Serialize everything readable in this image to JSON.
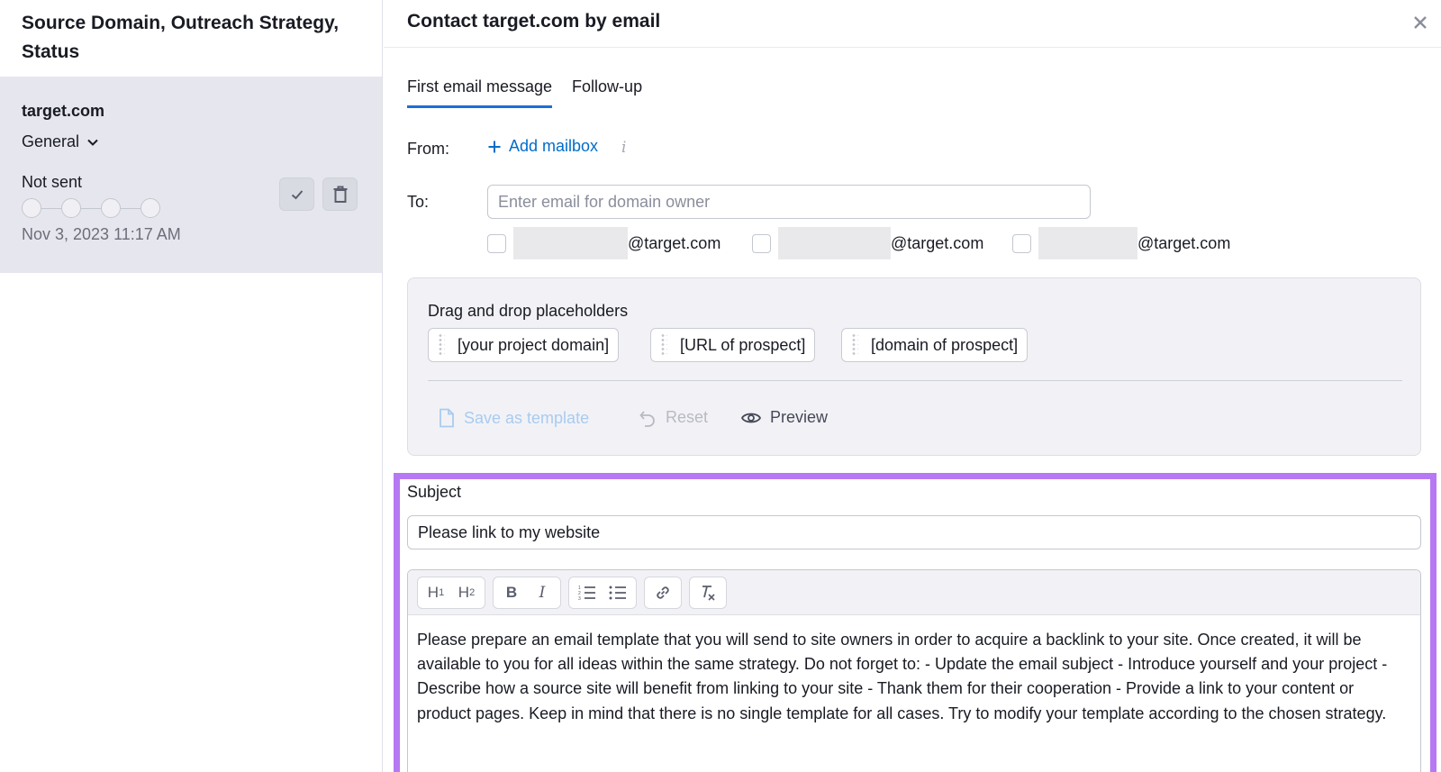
{
  "left_panel": {
    "header": "Source Domain, Outreach Strategy, Status",
    "card": {
      "domain": "target.com",
      "strategy": "General",
      "status": "Not sent",
      "date": "Nov 3, 2023 11:17 AM",
      "steps_count": 4
    }
  },
  "dialog": {
    "title": "Contact target.com by email",
    "tabs": [
      {
        "label": "First email message",
        "active": true
      },
      {
        "label": "Follow-up",
        "active": false
      }
    ],
    "from": {
      "label": "From:",
      "add_mailbox_label": "Add mailbox",
      "info_icon": "i"
    },
    "to": {
      "label": "To:",
      "placeholder": "Enter email for domain owner",
      "candidates": [
        {
          "suffix": "@target.com",
          "checked": false
        },
        {
          "suffix": "@target.com",
          "checked": false
        },
        {
          "suffix": "@target.com",
          "checked": false
        }
      ]
    },
    "placeholders": {
      "title": "Drag and drop placeholders",
      "chips": [
        "[your project domain]",
        "[URL of prospect]",
        "[domain of prospect]"
      ],
      "actions": {
        "save_template": "Save as template",
        "reset": "Reset",
        "preview": "Preview"
      }
    },
    "subject": {
      "label": "Subject",
      "value": "Please link to my website"
    },
    "editor": {
      "toolbar": [
        "H1",
        "H2",
        "bold",
        "italic",
        "ordered-list",
        "bullet-list",
        "link",
        "clear-format"
      ],
      "body": "Please prepare an email template that you will send to site owners in order to acquire a backlink to your site. Once created, it will be available to you for all ideas within the same strategy. Do not forget to: - Update the email subject - Introduce yourself and your project - Describe how a source site will benefit from linking to your site - Thank them for their cooperation - Provide a link to your content or product pages. Keep in mind that there is no single template for all cases. Try to modify your template according to the chosen strategy."
    }
  },
  "colors": {
    "accent_blue": "#006dca",
    "tab_underline": "#1e6ed3",
    "highlight_border": "#b679f3",
    "card_bg": "#e6e7ee",
    "disabled_text": "#a9cbf0"
  }
}
